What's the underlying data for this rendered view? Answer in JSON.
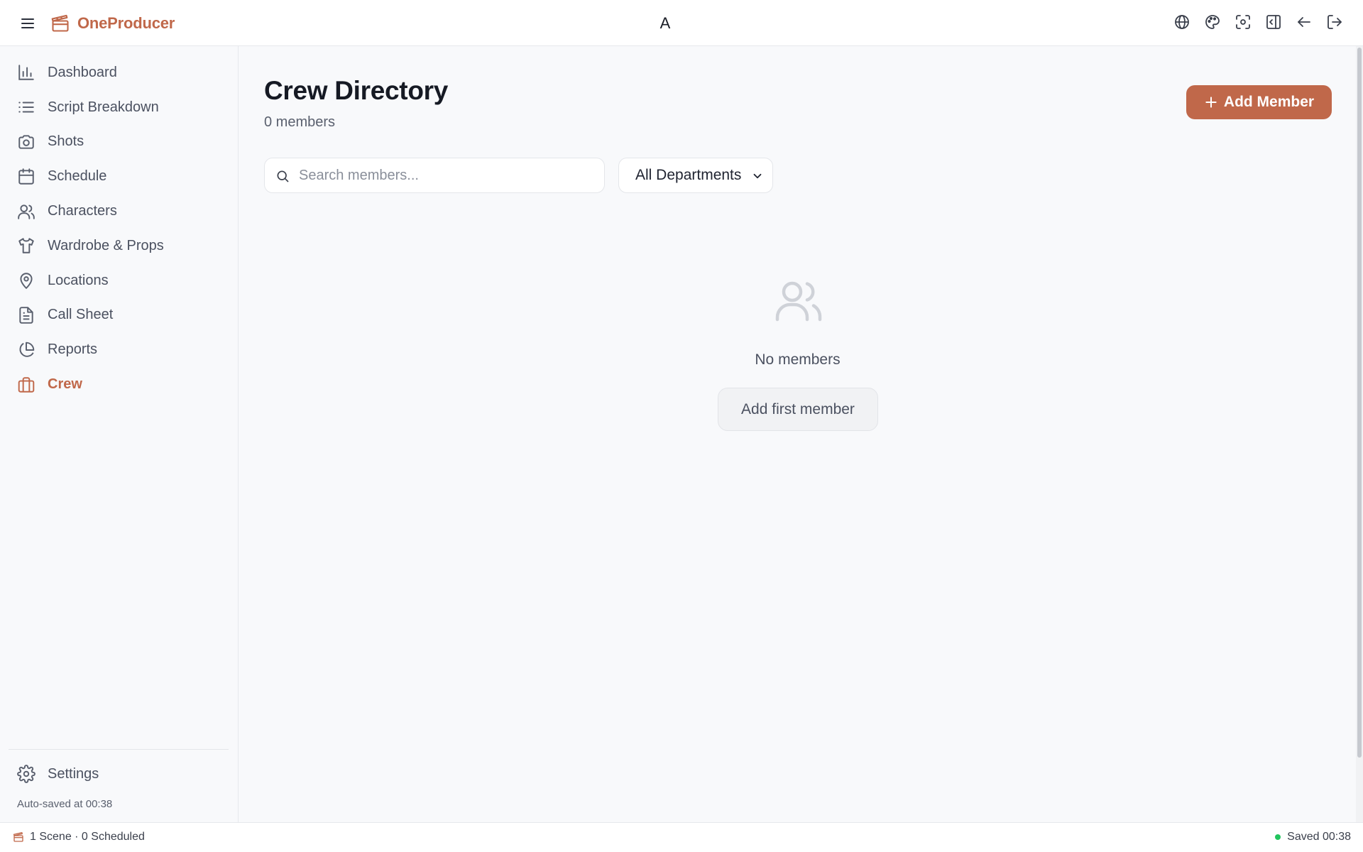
{
  "app": {
    "name": "OneProducer",
    "center_label": "A"
  },
  "topbar": {
    "icons": [
      "globe-icon",
      "palette-icon",
      "scan-icon",
      "sidebar-collapse-icon",
      "arrow-left-icon",
      "logout-icon"
    ]
  },
  "sidebar": {
    "items": [
      {
        "label": "Dashboard",
        "icon": "bar-chart-icon"
      },
      {
        "label": "Script Breakdown",
        "icon": "list-icon"
      },
      {
        "label": "Shots",
        "icon": "camera-icon"
      },
      {
        "label": "Schedule",
        "icon": "calendar-icon"
      },
      {
        "label": "Characters",
        "icon": "users-icon"
      },
      {
        "label": "Wardrobe & Props",
        "icon": "shirt-icon"
      },
      {
        "label": "Locations",
        "icon": "map-pin-icon"
      },
      {
        "label": "Call Sheet",
        "icon": "file-text-icon"
      },
      {
        "label": "Reports",
        "icon": "pie-chart-icon"
      },
      {
        "label": "Crew",
        "icon": "briefcase-icon",
        "active": true
      }
    ],
    "settings_label": "Settings",
    "autosave_text": "Auto-saved at 00:38"
  },
  "main": {
    "title": "Crew Directory",
    "member_count": "0 members",
    "add_member_label": "Add Member",
    "search_placeholder": "Search members...",
    "department_filter": "All Departments",
    "empty_text": "No members",
    "add_first_label": "Add first member"
  },
  "statusbar": {
    "left_text": "1 Scene · 0 Scheduled",
    "right_text": "Saved 00:38"
  },
  "colors": {
    "accent": "#c0684a",
    "saved_dot": "#22c55e"
  }
}
